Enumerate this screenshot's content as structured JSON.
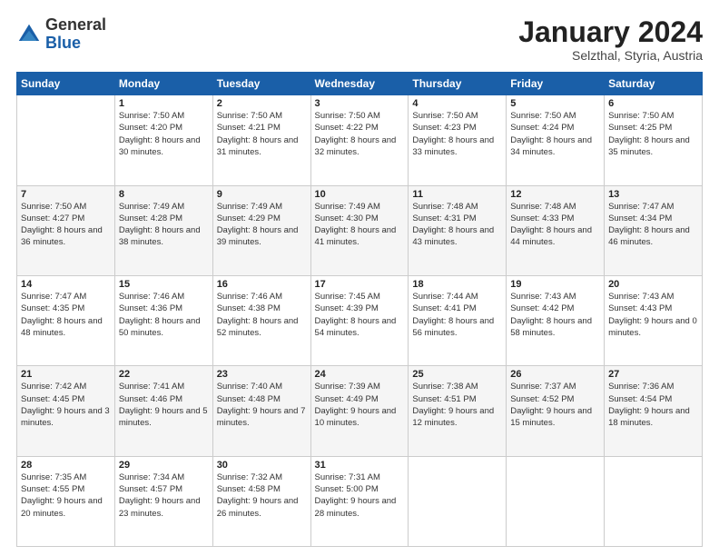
{
  "logo": {
    "general": "General",
    "blue": "Blue"
  },
  "header": {
    "title": "January 2024",
    "subtitle": "Selzthal, Styria, Austria"
  },
  "weekdays": [
    "Sunday",
    "Monday",
    "Tuesday",
    "Wednesday",
    "Thursday",
    "Friday",
    "Saturday"
  ],
  "weeks": [
    [
      {
        "day": null,
        "sunrise": null,
        "sunset": null,
        "daylight": null
      },
      {
        "day": "1",
        "sunrise": "Sunrise: 7:50 AM",
        "sunset": "Sunset: 4:20 PM",
        "daylight": "Daylight: 8 hours and 30 minutes."
      },
      {
        "day": "2",
        "sunrise": "Sunrise: 7:50 AM",
        "sunset": "Sunset: 4:21 PM",
        "daylight": "Daylight: 8 hours and 31 minutes."
      },
      {
        "day": "3",
        "sunrise": "Sunrise: 7:50 AM",
        "sunset": "Sunset: 4:22 PM",
        "daylight": "Daylight: 8 hours and 32 minutes."
      },
      {
        "day": "4",
        "sunrise": "Sunrise: 7:50 AM",
        "sunset": "Sunset: 4:23 PM",
        "daylight": "Daylight: 8 hours and 33 minutes."
      },
      {
        "day": "5",
        "sunrise": "Sunrise: 7:50 AM",
        "sunset": "Sunset: 4:24 PM",
        "daylight": "Daylight: 8 hours and 34 minutes."
      },
      {
        "day": "6",
        "sunrise": "Sunrise: 7:50 AM",
        "sunset": "Sunset: 4:25 PM",
        "daylight": "Daylight: 8 hours and 35 minutes."
      }
    ],
    [
      {
        "day": "7",
        "sunrise": "Sunrise: 7:50 AM",
        "sunset": "Sunset: 4:27 PM",
        "daylight": "Daylight: 8 hours and 36 minutes."
      },
      {
        "day": "8",
        "sunrise": "Sunrise: 7:49 AM",
        "sunset": "Sunset: 4:28 PM",
        "daylight": "Daylight: 8 hours and 38 minutes."
      },
      {
        "day": "9",
        "sunrise": "Sunrise: 7:49 AM",
        "sunset": "Sunset: 4:29 PM",
        "daylight": "Daylight: 8 hours and 39 minutes."
      },
      {
        "day": "10",
        "sunrise": "Sunrise: 7:49 AM",
        "sunset": "Sunset: 4:30 PM",
        "daylight": "Daylight: 8 hours and 41 minutes."
      },
      {
        "day": "11",
        "sunrise": "Sunrise: 7:48 AM",
        "sunset": "Sunset: 4:31 PM",
        "daylight": "Daylight: 8 hours and 43 minutes."
      },
      {
        "day": "12",
        "sunrise": "Sunrise: 7:48 AM",
        "sunset": "Sunset: 4:33 PM",
        "daylight": "Daylight: 8 hours and 44 minutes."
      },
      {
        "day": "13",
        "sunrise": "Sunrise: 7:47 AM",
        "sunset": "Sunset: 4:34 PM",
        "daylight": "Daylight: 8 hours and 46 minutes."
      }
    ],
    [
      {
        "day": "14",
        "sunrise": "Sunrise: 7:47 AM",
        "sunset": "Sunset: 4:35 PM",
        "daylight": "Daylight: 8 hours and 48 minutes."
      },
      {
        "day": "15",
        "sunrise": "Sunrise: 7:46 AM",
        "sunset": "Sunset: 4:36 PM",
        "daylight": "Daylight: 8 hours and 50 minutes."
      },
      {
        "day": "16",
        "sunrise": "Sunrise: 7:46 AM",
        "sunset": "Sunset: 4:38 PM",
        "daylight": "Daylight: 8 hours and 52 minutes."
      },
      {
        "day": "17",
        "sunrise": "Sunrise: 7:45 AM",
        "sunset": "Sunset: 4:39 PM",
        "daylight": "Daylight: 8 hours and 54 minutes."
      },
      {
        "day": "18",
        "sunrise": "Sunrise: 7:44 AM",
        "sunset": "Sunset: 4:41 PM",
        "daylight": "Daylight: 8 hours and 56 minutes."
      },
      {
        "day": "19",
        "sunrise": "Sunrise: 7:43 AM",
        "sunset": "Sunset: 4:42 PM",
        "daylight": "Daylight: 8 hours and 58 minutes."
      },
      {
        "day": "20",
        "sunrise": "Sunrise: 7:43 AM",
        "sunset": "Sunset: 4:43 PM",
        "daylight": "Daylight: 9 hours and 0 minutes."
      }
    ],
    [
      {
        "day": "21",
        "sunrise": "Sunrise: 7:42 AM",
        "sunset": "Sunset: 4:45 PM",
        "daylight": "Daylight: 9 hours and 3 minutes."
      },
      {
        "day": "22",
        "sunrise": "Sunrise: 7:41 AM",
        "sunset": "Sunset: 4:46 PM",
        "daylight": "Daylight: 9 hours and 5 minutes."
      },
      {
        "day": "23",
        "sunrise": "Sunrise: 7:40 AM",
        "sunset": "Sunset: 4:48 PM",
        "daylight": "Daylight: 9 hours and 7 minutes."
      },
      {
        "day": "24",
        "sunrise": "Sunrise: 7:39 AM",
        "sunset": "Sunset: 4:49 PM",
        "daylight": "Daylight: 9 hours and 10 minutes."
      },
      {
        "day": "25",
        "sunrise": "Sunrise: 7:38 AM",
        "sunset": "Sunset: 4:51 PM",
        "daylight": "Daylight: 9 hours and 12 minutes."
      },
      {
        "day": "26",
        "sunrise": "Sunrise: 7:37 AM",
        "sunset": "Sunset: 4:52 PM",
        "daylight": "Daylight: 9 hours and 15 minutes."
      },
      {
        "day": "27",
        "sunrise": "Sunrise: 7:36 AM",
        "sunset": "Sunset: 4:54 PM",
        "daylight": "Daylight: 9 hours and 18 minutes."
      }
    ],
    [
      {
        "day": "28",
        "sunrise": "Sunrise: 7:35 AM",
        "sunset": "Sunset: 4:55 PM",
        "daylight": "Daylight: 9 hours and 20 minutes."
      },
      {
        "day": "29",
        "sunrise": "Sunrise: 7:34 AM",
        "sunset": "Sunset: 4:57 PM",
        "daylight": "Daylight: 9 hours and 23 minutes."
      },
      {
        "day": "30",
        "sunrise": "Sunrise: 7:32 AM",
        "sunset": "Sunset: 4:58 PM",
        "daylight": "Daylight: 9 hours and 26 minutes."
      },
      {
        "day": "31",
        "sunrise": "Sunrise: 7:31 AM",
        "sunset": "Sunset: 5:00 PM",
        "daylight": "Daylight: 9 hours and 28 minutes."
      },
      {
        "day": null,
        "sunrise": null,
        "sunset": null,
        "daylight": null
      },
      {
        "day": null,
        "sunrise": null,
        "sunset": null,
        "daylight": null
      },
      {
        "day": null,
        "sunrise": null,
        "sunset": null,
        "daylight": null
      }
    ]
  ]
}
